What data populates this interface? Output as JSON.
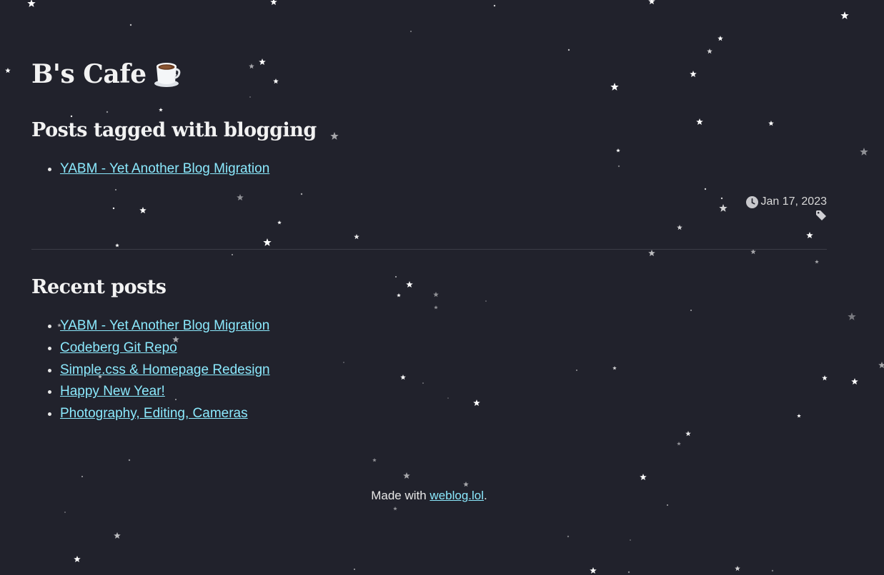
{
  "site": {
    "title": "B's Cafe"
  },
  "tagged": {
    "heading": "Posts tagged with blogging",
    "posts": [
      "YABM - Yet Another Blog Migration"
    ],
    "date": "Jan 17, 2023"
  },
  "recent": {
    "heading": "Recent posts",
    "posts": [
      "YABM - Yet Another Blog Migration",
      "Codeberg Git Repo",
      "Simple.css & Homepage Redesign",
      "Happy New Year!",
      "Photography, Editing, Cameras"
    ]
  },
  "footer": {
    "prefix": "Made with ",
    "link": "weblog.lol",
    "suffix": "."
  },
  "icons": {
    "title_icon": "coffee-cup-icon",
    "date_icon": "clock-icon",
    "tag_icon": "tag-icon",
    "background": "star-icon"
  },
  "colors": {
    "background": "#21222c",
    "link": "#8be9fd",
    "text": "#e8e8e8"
  }
}
